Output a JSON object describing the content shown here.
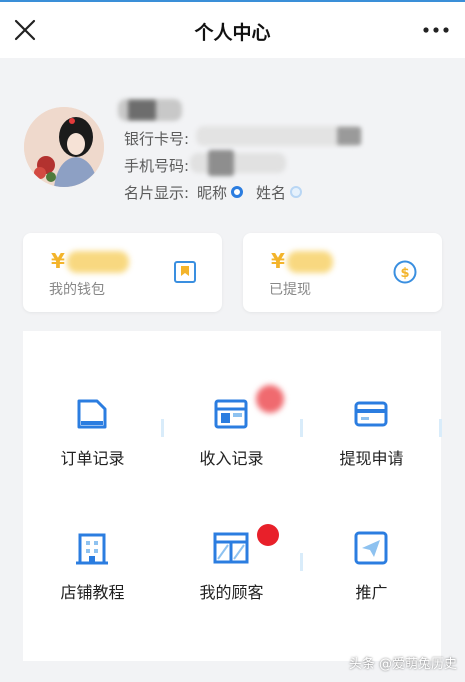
{
  "header": {
    "title": "个人中心"
  },
  "profile": {
    "bank_label": "银行卡号:",
    "phone_label": "手机号码:",
    "card_display_label": "名片显示:",
    "options": [
      "昵称",
      "姓名"
    ],
    "selected_option": "昵称"
  },
  "wallet": {
    "my_wallet": {
      "currency": "¥",
      "label": "我的钱包"
    },
    "withdrawn": {
      "currency": "¥",
      "label": "已提现"
    }
  },
  "menu": [
    {
      "label": "订单记录",
      "icon": "order-record-icon"
    },
    {
      "label": "收入记录",
      "icon": "income-record-icon"
    },
    {
      "label": "提现申请",
      "icon": "withdraw-card-icon"
    },
    {
      "label": "店铺教程",
      "icon": "shop-building-icon"
    },
    {
      "label": "我的顾客",
      "icon": "customers-panel-icon"
    },
    {
      "label": "推广",
      "icon": "send-plane-icon"
    }
  ],
  "watermark": "头条 @爱萌兔历史",
  "colors": {
    "accent": "#2b7de0",
    "amount": "#f3b42b",
    "badge": "#e8202a"
  }
}
